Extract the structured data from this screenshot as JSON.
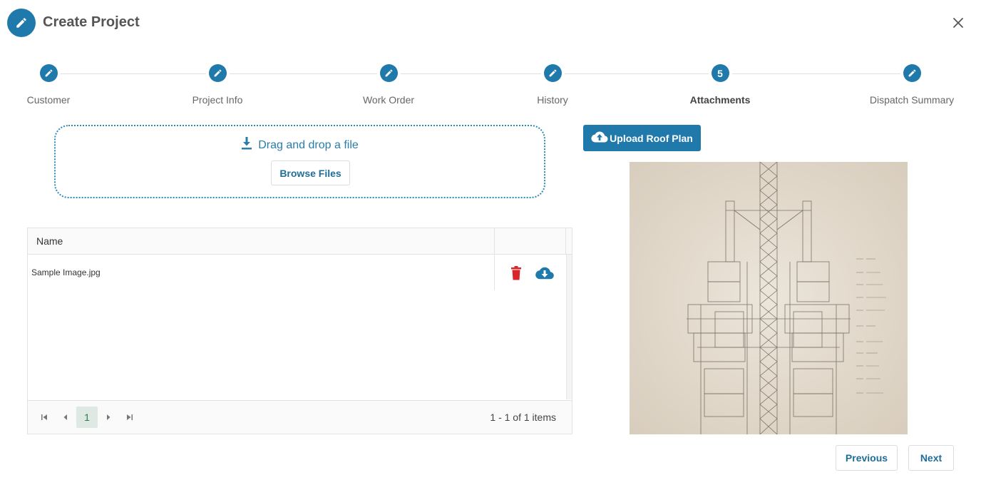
{
  "header": {
    "title": "Create Project"
  },
  "stepper": {
    "steps": [
      {
        "label": "Customer",
        "marker": ""
      },
      {
        "label": "Project Info",
        "marker": ""
      },
      {
        "label": "Work Order",
        "marker": ""
      },
      {
        "label": "History",
        "marker": ""
      },
      {
        "label": "Attachments",
        "marker": "5"
      },
      {
        "label": "Dispatch Summary",
        "marker": ""
      }
    ],
    "active_index": 4
  },
  "upload": {
    "drop_text": "Drag and drop a file",
    "browse_label": "Browse Files"
  },
  "grid": {
    "column_name": "Name",
    "rows": [
      {
        "name": "Sample Image.jpg"
      }
    ],
    "pager": {
      "current_page": "1",
      "info": "1 - 1 of 1 items"
    }
  },
  "roof_plan": {
    "upload_label": "Upload Roof Plan"
  },
  "footer": {
    "previous_label": "Previous",
    "next_label": "Next"
  },
  "colors": {
    "primary": "#1f7aab",
    "delete": "#d9262c",
    "pager_active_bg": "#dde9e2"
  }
}
